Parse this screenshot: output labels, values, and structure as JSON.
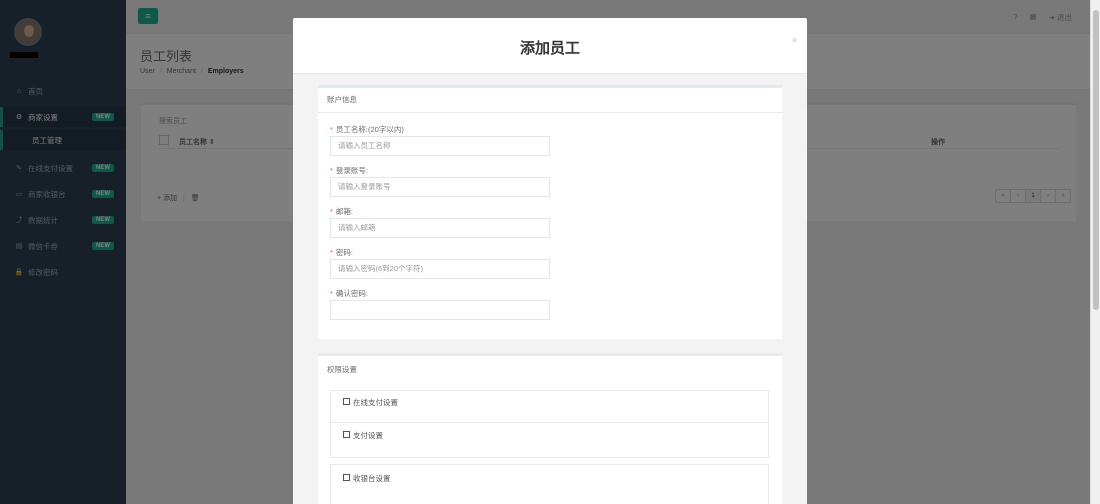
{
  "sidebar": {
    "items": [
      {
        "icon": "home-icon",
        "glyph": "⌂",
        "label": "首页"
      },
      {
        "icon": "gears-icon",
        "glyph": "⚙",
        "label": "商家设置",
        "badge": "NEW"
      },
      {
        "label": "员工管理"
      },
      {
        "icon": "wrench-icon",
        "glyph": "✎",
        "label": "在线支付设置",
        "badge": "NEW"
      },
      {
        "icon": "monitor-icon",
        "glyph": "▭",
        "label": "商家收银台",
        "badge": "NEW"
      },
      {
        "icon": "chart-icon",
        "glyph": "⤴",
        "label": "数据统计",
        "badge": "NEW"
      },
      {
        "icon": "card-icon",
        "glyph": "▤",
        "label": "微信卡券",
        "badge": "NEW"
      },
      {
        "icon": "lock-icon",
        "glyph": "🔒",
        "label": "修改密码"
      }
    ]
  },
  "topbar": {
    "menu_glyph": "≡",
    "help_glyph": "?",
    "grid_glyph": "▦",
    "logout_label": "➜ 退出"
  },
  "heading": {
    "title": "员工列表",
    "crumbs": [
      "User",
      "Merchant",
      "Employers"
    ]
  },
  "table": {
    "search_label": "搜索员工",
    "col_name": "员工名称 ⇕",
    "col_op": "操作",
    "add_label": "+ 添加",
    "trash": "🗑",
    "pager": [
      "«",
      "‹",
      "1",
      "›",
      "»"
    ]
  },
  "modal": {
    "title": "添加员工",
    "close": "×",
    "account_section": "账户信息",
    "fields": [
      {
        "label": "员工名称:(20字以内)",
        "placeholder": "请输入员工名称"
      },
      {
        "label": "登录账号:",
        "placeholder": "请输入登录账号"
      },
      {
        "label": "邮箱:",
        "placeholder": "请输入邮箱"
      },
      {
        "label": "密码:",
        "placeholder": "请输入密码(6到20个字符)"
      },
      {
        "label": "确认密码:",
        "placeholder": ""
      }
    ],
    "perm_section": "权限设置",
    "perms": [
      "在线支付设置",
      "支付设置",
      "收银台设置"
    ]
  }
}
